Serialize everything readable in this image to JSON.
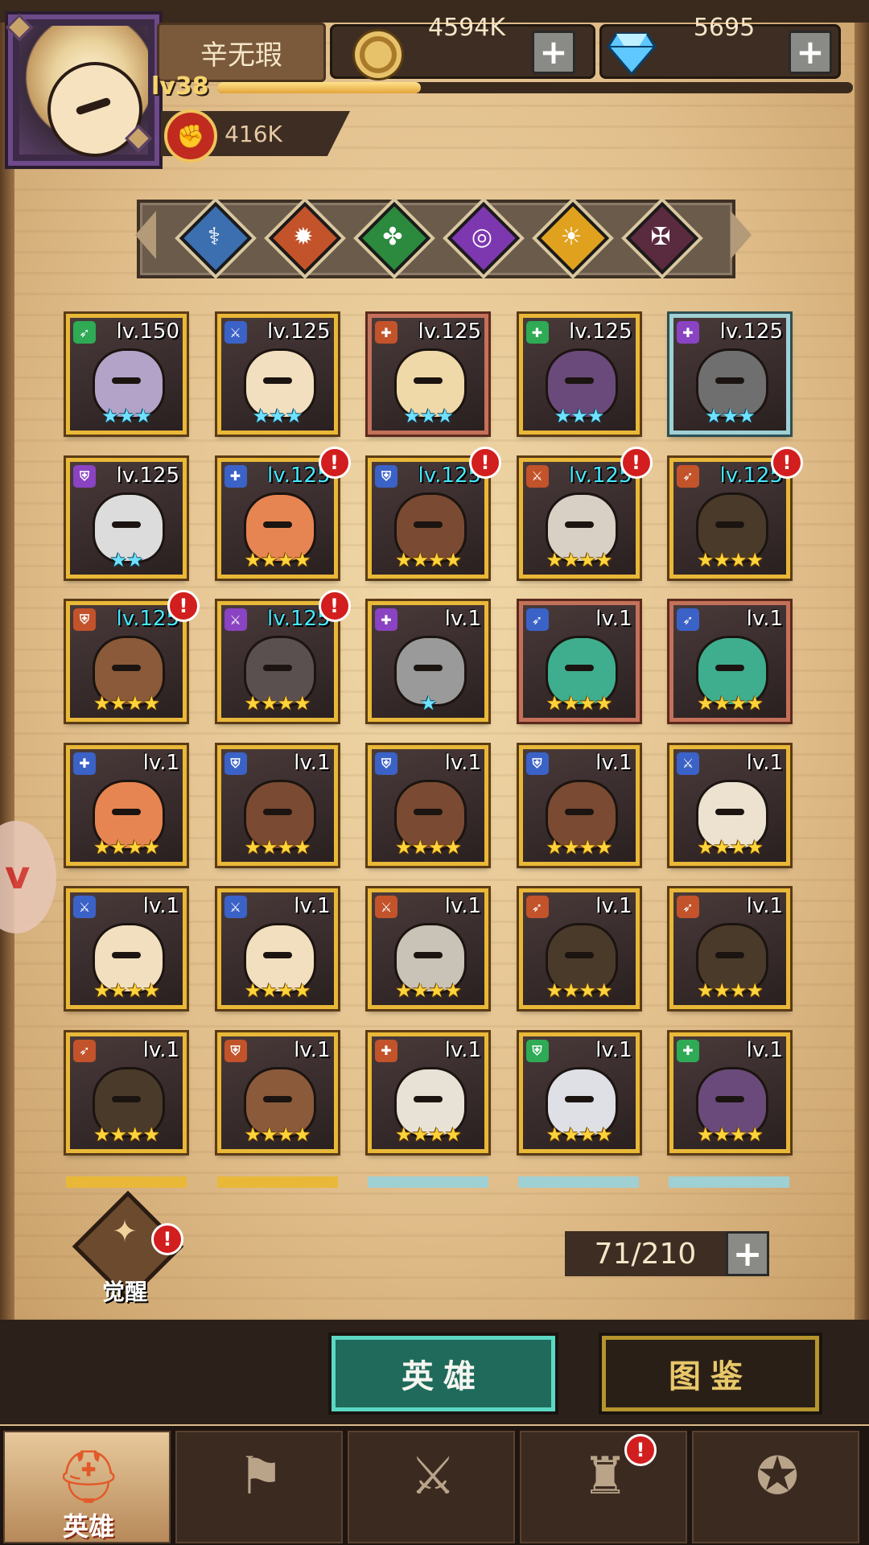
{
  "player": {
    "name": "辛无瑕",
    "level": "lv38",
    "exp_fraction": 0.32,
    "power": "416K"
  },
  "resources": {
    "gold": "4594K",
    "gems": "5695"
  },
  "filter": {
    "factions": [
      {
        "icon": "light-faction-icon",
        "color": "#3b6fb0"
      },
      {
        "icon": "fire-faction-icon",
        "color": "#c2532a"
      },
      {
        "icon": "clover-faction-icon",
        "color": "#2b8a3e"
      },
      {
        "icon": "void-faction-icon",
        "color": "#7d38b0"
      },
      {
        "icon": "sun-faction-icon",
        "color": "#e0a21e"
      },
      {
        "icon": "shadow-faction-icon",
        "color": "#5a2a3e"
      }
    ]
  },
  "heroes": [
    {
      "level": "lv.150",
      "role": "bow",
      "role_color": "#2faa55",
      "stars": "★★★",
      "star_color": "blue",
      "frame": "gold",
      "level_color": "white",
      "alert": false,
      "skin": "#b3a3c9"
    },
    {
      "level": "lv.125",
      "role": "sword",
      "role_color": "#3b62c7",
      "stars": "★★★",
      "star_color": "blue",
      "frame": "gold",
      "level_color": "white",
      "alert": false,
      "skin": "#f1dfbf"
    },
    {
      "level": "lv.125",
      "role": "heal",
      "role_color": "#c2532a",
      "stars": "★★★",
      "star_color": "blue",
      "frame": "red",
      "level_color": "white",
      "alert": false,
      "skin": "#f0d9a8"
    },
    {
      "level": "lv.125",
      "role": "heal",
      "role_color": "#2faa55",
      "stars": "★★★",
      "star_color": "blue",
      "frame": "gold",
      "level_color": "white",
      "alert": false,
      "skin": "#6a4a7a"
    },
    {
      "level": "lv.125",
      "role": "heal",
      "role_color": "#8a43c2",
      "stars": "★★★",
      "star_color": "blue",
      "frame": "silver",
      "level_color": "white",
      "alert": false,
      "skin": "#6f6f70"
    },
    {
      "level": "lv.125",
      "role": "shield",
      "role_color": "#8a43c2",
      "stars": "★★",
      "star_color": "blue",
      "frame": "gold",
      "level_color": "white",
      "alert": false,
      "skin": "#dcdcdc"
    },
    {
      "level": "lv.125",
      "role": "heal",
      "role_color": "#3b62c7",
      "stars": "★★★★",
      "star_color": "gold",
      "frame": "gold",
      "level_color": "cyan",
      "alert": true,
      "skin": "#e78552"
    },
    {
      "level": "lv.125",
      "role": "shield",
      "role_color": "#3b62c7",
      "stars": "★★★★",
      "star_color": "gold",
      "frame": "gold",
      "level_color": "cyan",
      "alert": true,
      "skin": "#7a4a32"
    },
    {
      "level": "lv.125",
      "role": "sword",
      "role_color": "#c2532a",
      "stars": "★★★★",
      "star_color": "gold",
      "frame": "gold",
      "level_color": "cyan",
      "alert": true,
      "skin": "#d8d0c4"
    },
    {
      "level": "lv.125",
      "role": "bow",
      "role_color": "#c2532a",
      "stars": "★★★★",
      "star_color": "gold",
      "frame": "gold",
      "level_color": "cyan",
      "alert": true,
      "skin": "#4a3a2a"
    },
    {
      "level": "lv.125",
      "role": "shield",
      "role_color": "#c2532a",
      "stars": "★★★★",
      "star_color": "gold",
      "frame": "gold",
      "level_color": "cyan",
      "alert": true,
      "skin": "#8a5a3a"
    },
    {
      "level": "lv.125",
      "role": "sword",
      "role_color": "#8a43c2",
      "stars": "★★★★",
      "star_color": "gold",
      "frame": "gold",
      "level_color": "cyan",
      "alert": true,
      "skin": "#5a5050"
    },
    {
      "level": "lv.1",
      "role": "heal",
      "role_color": "#8a43c2",
      "stars": "★",
      "star_color": "blue",
      "frame": "gold",
      "level_color": "white",
      "alert": false,
      "skin": "#9a9a9a"
    },
    {
      "level": "lv.1",
      "role": "bow",
      "role_color": "#3b62c7",
      "stars": "★★★★",
      "star_color": "gold",
      "frame": "red",
      "level_color": "white",
      "alert": false,
      "skin": "#3fae8e"
    },
    {
      "level": "lv.1",
      "role": "bow",
      "role_color": "#3b62c7",
      "stars": "★★★★",
      "star_color": "gold",
      "frame": "red",
      "level_color": "white",
      "alert": false,
      "skin": "#3fae8e"
    },
    {
      "level": "lv.1",
      "role": "heal",
      "role_color": "#3b62c7",
      "stars": "★★★★",
      "star_color": "gold",
      "frame": "gold",
      "level_color": "white",
      "alert": false,
      "skin": "#e78552"
    },
    {
      "level": "lv.1",
      "role": "shield",
      "role_color": "#3b62c7",
      "stars": "★★★★",
      "star_color": "gold",
      "frame": "gold",
      "level_color": "white",
      "alert": false,
      "skin": "#7a4a32"
    },
    {
      "level": "lv.1",
      "role": "shield",
      "role_color": "#3b62c7",
      "stars": "★★★★",
      "star_color": "gold",
      "frame": "gold",
      "level_color": "white",
      "alert": false,
      "skin": "#7a4a32"
    },
    {
      "level": "lv.1",
      "role": "shield",
      "role_color": "#3b62c7",
      "stars": "★★★★",
      "star_color": "gold",
      "frame": "gold",
      "level_color": "white",
      "alert": false,
      "skin": "#7a4a32"
    },
    {
      "level": "lv.1",
      "role": "sword",
      "role_color": "#3b62c7",
      "stars": "★★★★",
      "star_color": "gold",
      "frame": "gold",
      "level_color": "white",
      "alert": false,
      "skin": "#ece2cf"
    },
    {
      "level": "lv.1",
      "role": "sword",
      "role_color": "#3b62c7",
      "stars": "★★★★",
      "star_color": "gold",
      "frame": "gold",
      "level_color": "white",
      "alert": false,
      "skin": "#f1dfbf"
    },
    {
      "level": "lv.1",
      "role": "sword",
      "role_color": "#3b62c7",
      "stars": "★★★★",
      "star_color": "gold",
      "frame": "gold",
      "level_color": "white",
      "alert": false,
      "skin": "#f1dfbf"
    },
    {
      "level": "lv.1",
      "role": "sword",
      "role_color": "#c2532a",
      "stars": "★★★★",
      "star_color": "gold",
      "frame": "gold",
      "level_color": "white",
      "alert": false,
      "skin": "#c9c2b6"
    },
    {
      "level": "lv.1",
      "role": "bow",
      "role_color": "#c2532a",
      "stars": "★★★★",
      "star_color": "gold",
      "frame": "gold",
      "level_color": "white",
      "alert": false,
      "skin": "#4a3a2a"
    },
    {
      "level": "lv.1",
      "role": "bow",
      "role_color": "#c2532a",
      "stars": "★★★★",
      "star_color": "gold",
      "frame": "gold",
      "level_color": "white",
      "alert": false,
      "skin": "#4a3a2a"
    },
    {
      "level": "lv.1",
      "role": "bow",
      "role_color": "#c2532a",
      "stars": "★★★★",
      "star_color": "gold",
      "frame": "gold",
      "level_color": "white",
      "alert": false,
      "skin": "#4a3a2a"
    },
    {
      "level": "lv.1",
      "role": "shield",
      "role_color": "#c2532a",
      "stars": "★★★★",
      "star_color": "gold",
      "frame": "gold",
      "level_color": "white",
      "alert": false,
      "skin": "#8a5a3a"
    },
    {
      "level": "lv.1",
      "role": "heal",
      "role_color": "#c2532a",
      "stars": "★★★★",
      "star_color": "gold",
      "frame": "gold",
      "level_color": "white",
      "alert": false,
      "skin": "#e8e2d6"
    },
    {
      "level": "lv.1",
      "role": "shield",
      "role_color": "#2faa55",
      "stars": "★★★★",
      "star_color": "gold",
      "frame": "gold",
      "level_color": "white",
      "alert": false,
      "skin": "#dfdfe6"
    },
    {
      "level": "lv.1",
      "role": "heal",
      "role_color": "#2faa55",
      "stars": "★★★★",
      "star_color": "gold",
      "frame": "gold",
      "level_color": "white",
      "alert": false,
      "skin": "#6a4a7a"
    }
  ],
  "awaken": {
    "label": "觉醒",
    "alert": true
  },
  "capacity": "71/210",
  "subtabs": [
    {
      "label": "英雄",
      "active": true
    },
    {
      "label": "图鉴",
      "active": false
    }
  ],
  "nav": [
    {
      "label": "英雄",
      "icon": "knight-helmet-icon",
      "active": true,
      "alert": false
    },
    {
      "label": "",
      "icon": "flag-map-icon",
      "active": false,
      "alert": false
    },
    {
      "label": "",
      "icon": "crossed-swords-icon",
      "active": false,
      "alert": false
    },
    {
      "label": "",
      "icon": "castle-tower-icon",
      "active": false,
      "alert": true
    },
    {
      "label": "",
      "icon": "guild-crest-icon",
      "active": false,
      "alert": false
    }
  ]
}
